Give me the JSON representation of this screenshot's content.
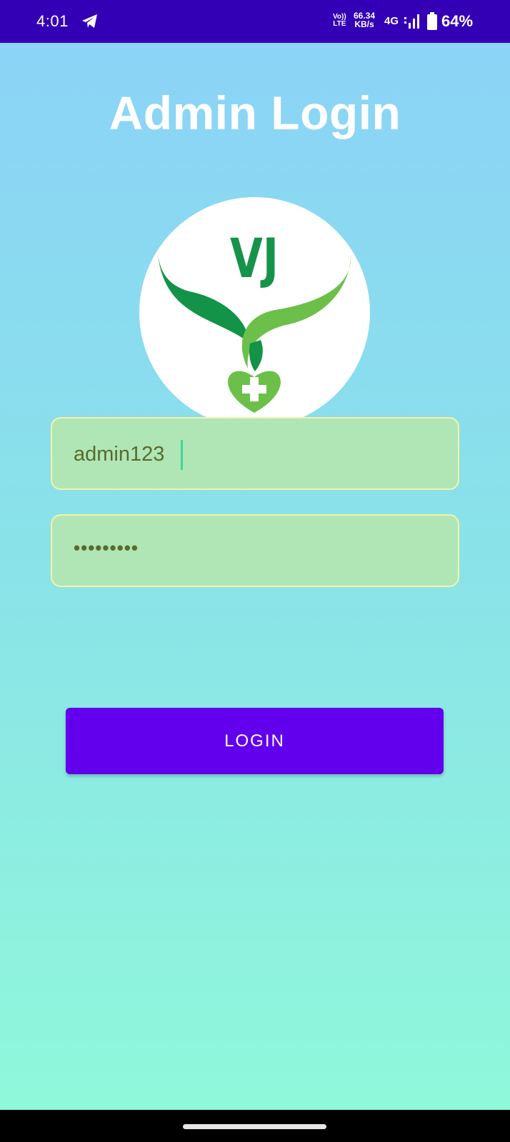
{
  "status_bar": {
    "time": "4:01",
    "telegram_icon": "telegram-icon",
    "volte_top": "Vo))",
    "volte_bottom": "LTE",
    "speed_value": "66.34",
    "speed_unit": "KB/s",
    "network": "4G",
    "signal_icon": "signal-icon",
    "battery_icon": "battery-icon",
    "battery": "64%",
    "background_color": "#3400b6"
  },
  "page": {
    "title": "Admin Login",
    "gradient_top": "#8bd3f7",
    "gradient_bottom": "#8ff8da"
  },
  "logo": {
    "text": "VJ",
    "icon": "vj-heart-logo"
  },
  "form": {
    "username_value": "admin123",
    "password_value": "•••••••••",
    "field_color": "#b0e6b5"
  },
  "login_button": {
    "label": "LOGIN",
    "color": "#6200ee"
  }
}
